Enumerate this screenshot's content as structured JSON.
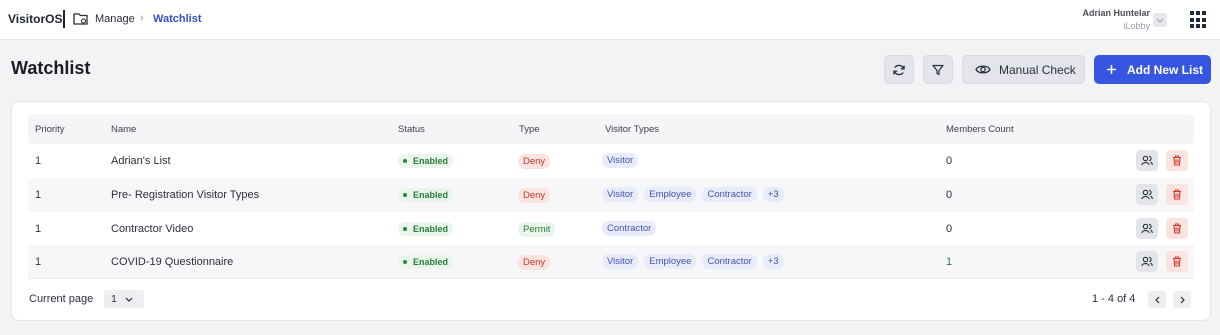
{
  "header": {
    "brand": "VisitorOS",
    "breadcrumb": {
      "parent": "Manage",
      "current": "Watchlist"
    },
    "user": {
      "name": "Adrian Huntelar",
      "org": "iLobby"
    }
  },
  "page": {
    "title": "Watchlist",
    "buttons": {
      "manual_check": "Manual Check",
      "add_new_list": "Add New List"
    }
  },
  "table": {
    "columns": [
      "Priority",
      "Name",
      "Status",
      "Type",
      "Visitor Types",
      "Members Count"
    ],
    "rows": [
      {
        "priority": "1",
        "name": "Adrian's List",
        "status": "Enabled",
        "type": "Deny",
        "visitor_types": [
          "Visitor"
        ],
        "members": "0"
      },
      {
        "priority": "1",
        "name": "Pre- Registration Visitor Types",
        "status": "Enabled",
        "type": "Deny",
        "visitor_types": [
          "Visitor",
          "Employee",
          "Contractor",
          "+3"
        ],
        "members": "0"
      },
      {
        "priority": "1",
        "name": "Contractor Video",
        "status": "Enabled",
        "type": "Permit",
        "visitor_types": [
          "Contractor"
        ],
        "members": "0"
      },
      {
        "priority": "1",
        "name": "COVID-19 Questionnaire",
        "status": "Enabled",
        "type": "Deny",
        "visitor_types": [
          "Visitor",
          "Employee",
          "Contractor",
          "+3"
        ],
        "members": "1"
      }
    ]
  },
  "pagination": {
    "label": "Current page",
    "current": "1",
    "range": "1 - 4 of 4"
  },
  "colors": {
    "accent": "#3655e0",
    "enabled": "#2a7b3a",
    "deny": "#c0392b",
    "chip": "#4256b5"
  }
}
